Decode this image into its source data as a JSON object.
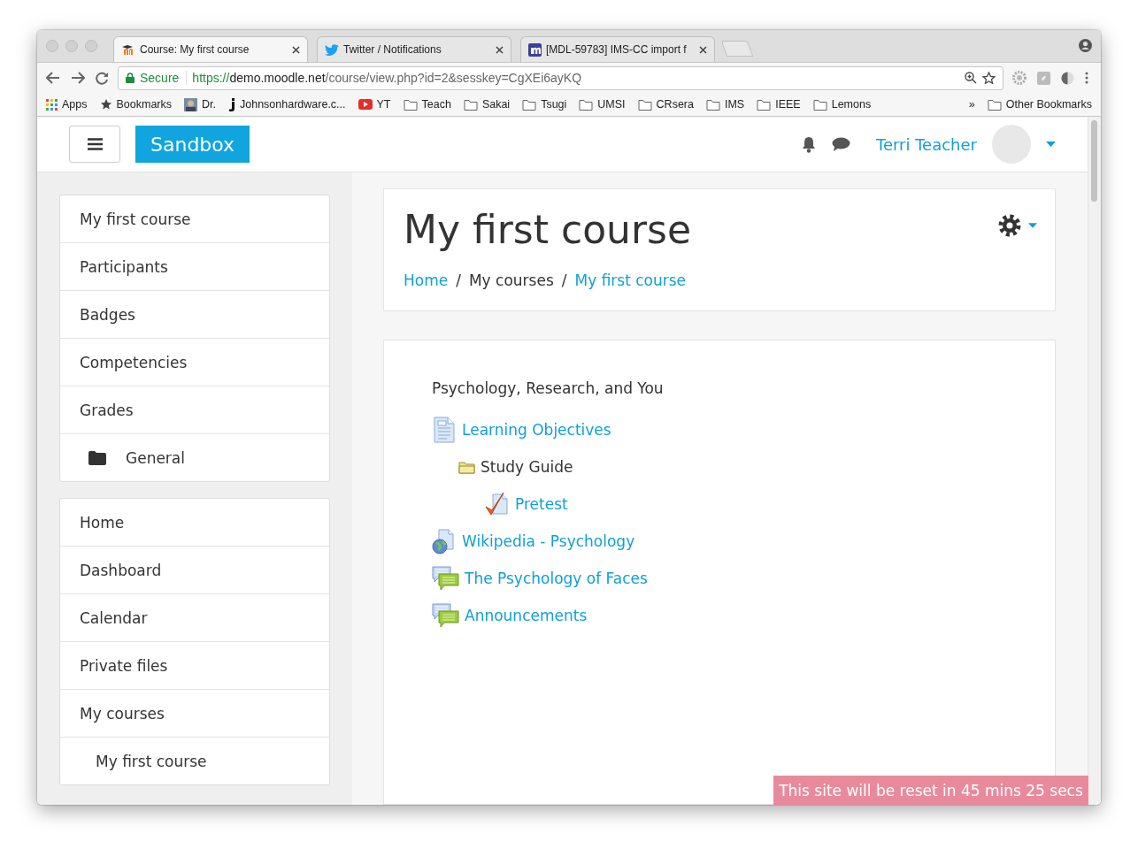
{
  "browser": {
    "tabs": [
      {
        "title": "Course: My first course",
        "kind": "moodle",
        "selected": true
      },
      {
        "title": "Twitter / Notifications",
        "kind": "bird",
        "selected": false
      },
      {
        "title": "[MDL-59783] IMS-CC import f",
        "kind": "tracker",
        "selected": false
      }
    ],
    "address": {
      "secure_label": "Secure",
      "scheme": "https://",
      "host": "demo.moodle.net",
      "path": "/course/view.php?id=2&sesskey=CgXEi6ayKQ"
    },
    "bookmarks": [
      {
        "label": "Apps",
        "kind": "apps"
      },
      {
        "label": "Bookmarks",
        "kind": "star"
      },
      {
        "label": "Dr.",
        "kind": "picture"
      },
      {
        "label": "Johnsonhardware.c...",
        "kind": "favicon"
      },
      {
        "label": "YT",
        "kind": "video"
      },
      {
        "label": "Teach",
        "kind": "folder"
      },
      {
        "label": "Sakai",
        "kind": "folder"
      },
      {
        "label": "Tsugi",
        "kind": "folder"
      },
      {
        "label": "UMSI",
        "kind": "folder"
      },
      {
        "label": "CRsera",
        "kind": "folder"
      },
      {
        "label": "IMS",
        "kind": "folder"
      },
      {
        "label": "IEEE",
        "kind": "folder"
      },
      {
        "label": "Lemons",
        "kind": "folder"
      }
    ],
    "overflow": "»",
    "other_bookmarks": "Other Bookmarks"
  },
  "navbar": {
    "brand": "Sandbox",
    "user": "Terri Teacher"
  },
  "sidebar": {
    "groups": [
      [
        {
          "label": "My first course",
          "kind": "link"
        },
        {
          "label": "Participants",
          "kind": "link"
        },
        {
          "label": "Badges",
          "kind": "link"
        },
        {
          "label": "Competencies",
          "kind": "link"
        },
        {
          "label": "Grades",
          "kind": "link"
        },
        {
          "label": "General",
          "kind": "section"
        }
      ],
      [
        {
          "label": "Home",
          "kind": "link"
        },
        {
          "label": "Dashboard",
          "kind": "link"
        },
        {
          "label": "Calendar",
          "kind": "link"
        },
        {
          "label": "Private files",
          "kind": "link"
        },
        {
          "label": "My courses",
          "kind": "link",
          "children": [
            {
              "label": "My first course",
              "kind": "link"
            }
          ]
        }
      ]
    ]
  },
  "header": {
    "title": "My first course",
    "breadcrumb": [
      {
        "label": "Home",
        "link": true
      },
      {
        "label": "My courses",
        "link": false
      },
      {
        "label": "My first course",
        "link": true
      }
    ],
    "separator": "/"
  },
  "section": {
    "title": "Psychology, Research, and You",
    "activities": [
      {
        "label": "Learning Objectives",
        "kind": "page",
        "children": [
          {
            "label": "Study Guide",
            "kind": "folder",
            "children": [
              {
                "label": "Pretest",
                "kind": "quiz"
              }
            ]
          }
        ]
      },
      {
        "label": "Wikipedia - Psychology",
        "kind": "url"
      },
      {
        "label": "The Psychology of Faces",
        "kind": "forum"
      },
      {
        "label": "Announcements",
        "kind": "forum"
      }
    ]
  },
  "reset_notice": "This site will be reset in 45 mins 25 secs"
}
